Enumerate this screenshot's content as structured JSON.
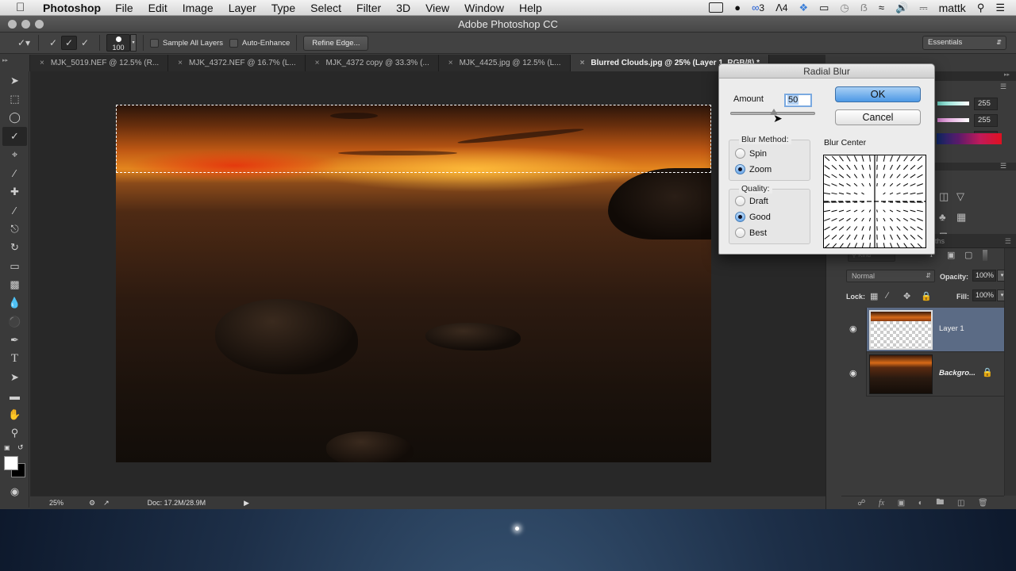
{
  "menubar": {
    "app_name": "Photoshop",
    "items": [
      "File",
      "Edit",
      "Image",
      "Layer",
      "Type",
      "Select",
      "Filter",
      "3D",
      "View",
      "Window",
      "Help"
    ],
    "status": {
      "creative_cloud_count": "3",
      "adobe_count": "4",
      "user": "mattk"
    }
  },
  "window": {
    "title": "Adobe Photoshop CC"
  },
  "options_bar": {
    "brush_size": "100",
    "sample_all_layers_label": "Sample All Layers",
    "sample_all_layers_checked": false,
    "auto_enhance_label": "Auto-Enhance",
    "auto_enhance_checked": false,
    "refine_edge_label": "Refine Edge...",
    "workspace": "Essentials"
  },
  "document_tabs": [
    {
      "label": "MJK_5019.NEF @ 12.5% (R...",
      "active": false
    },
    {
      "label": "MJK_4372.NEF @ 16.7% (L...",
      "active": false
    },
    {
      "label": "MJK_4372 copy @ 33.3% (...",
      "active": false
    },
    {
      "label": "MJK_4425.jpg @ 12.5% (L...",
      "active": false
    },
    {
      "label": "Blurred Clouds.jpg @ 25% (Layer 1, RGB/8) *",
      "active": true
    }
  ],
  "tools": [
    "move-tool",
    "marquee-tool",
    "lasso-tool",
    "quick-selection-tool",
    "crop-tool",
    "eyedropper-tool",
    "healing-brush-tool",
    "brush-tool",
    "clone-stamp-tool",
    "history-brush-tool",
    "eraser-tool",
    "gradient-tool",
    "blur-tool",
    "dodge-tool",
    "pen-tool",
    "type-tool",
    "path-selection-tool",
    "rectangle-tool",
    "hand-tool",
    "zoom-tool"
  ],
  "status_bar": {
    "zoom": "25%",
    "doc_info": "Doc: 17.2M/28.9M"
  },
  "color_panel": {
    "r": "255",
    "g": "255",
    "b": "255"
  },
  "layers_panel": {
    "tab_partial": "ths",
    "filter_placeholder": "Kind",
    "blend_mode": "Normal",
    "opacity_label": "Opacity:",
    "opacity": "100%",
    "lock_label": "Lock:",
    "fill_label": "Fill:",
    "fill": "100%",
    "layers": [
      {
        "name": "Layer 1",
        "selected": true,
        "visible": true,
        "locked": false
      },
      {
        "name": "Backgro...",
        "selected": false,
        "visible": true,
        "locked": true
      }
    ]
  },
  "radial_blur_dialog": {
    "title": "Radial Blur",
    "amount_label": "Amount",
    "amount": "50",
    "amount_fraction": 0.5,
    "ok_label": "OK",
    "cancel_label": "Cancel",
    "blur_method_label": "Blur Method:",
    "blur_methods": [
      "Spin",
      "Zoom"
    ],
    "blur_method_selected": "Zoom",
    "quality_label": "Quality:",
    "qualities": [
      "Draft",
      "Good",
      "Best"
    ],
    "quality_selected": "Good",
    "blur_center_label": "Blur Center"
  }
}
